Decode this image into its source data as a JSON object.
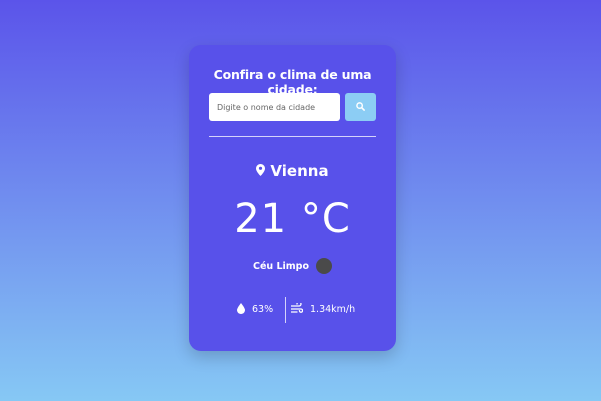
{
  "card": {
    "title": "Confira o clima de uma cidade:",
    "search": {
      "placeholder": "Digite o nome da cidade",
      "value": ""
    }
  },
  "weather": {
    "city": "Vienna",
    "temperature": "21",
    "unit": "°C",
    "description": "Céu Limpo",
    "humidity": "63%",
    "wind": "1.34km/h"
  },
  "icons": {
    "search_button": "search-icon",
    "city": "map-marker-icon",
    "weather": "weather-icon",
    "humidity": "droplet-icon",
    "wind": "wind-icon"
  },
  "colors": {
    "card_background": "#5851ea",
    "button_background": "#8ccdf4",
    "weather_icon": "#4a4a4a"
  }
}
